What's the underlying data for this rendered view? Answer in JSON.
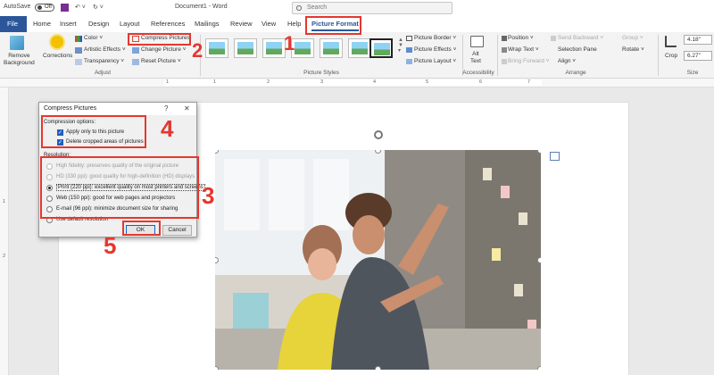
{
  "titlebar": {
    "autosave": "AutoSave",
    "toggle": "Off",
    "doc_title": "Document1 - Word",
    "search_placeholder": "Search"
  },
  "tabs": {
    "file": "File",
    "items": [
      "Home",
      "Insert",
      "Design",
      "Layout",
      "References",
      "Mailings",
      "Review",
      "View",
      "Help"
    ],
    "picture_format": "Picture Format"
  },
  "ribbon": {
    "remove_background": "Remove\nBackground",
    "corrections": "Corrections",
    "color": "Color ˅",
    "artistic_effects": "Artistic Effects ˅",
    "transparency": "Transparency ˅",
    "compress_pictures": "Compress Pictures",
    "change_picture": "Change Picture ˅",
    "reset_picture": "Reset Picture ˅",
    "adjust_group": "Adjust",
    "picture_border": "Picture Border ˅",
    "picture_effects": "Picture Effects ˅",
    "picture_layout": "Picture Layout ˅",
    "picture_styles_group": "Picture Styles",
    "alt_text": "Alt\nText",
    "accessibility_group": "Accessibility",
    "position": "Position ˅",
    "wrap_text": "Wrap Text ˅",
    "bring_forward": "Bring Forward ˅",
    "send_backward": "Send Backward ˅",
    "selection_pane": "Selection Pane",
    "align": "Align ˅",
    "group": "Group ˅",
    "rotate": "Rotate ˅",
    "arrange_group": "Arrange",
    "crop": "Crop",
    "height": "4.18\"",
    "width": "6.27\"",
    "size_group": "Size"
  },
  "ruler": {
    "ticks": [
      "1",
      "1",
      "2",
      "3",
      "4",
      "5",
      "6",
      "7"
    ],
    "left_ticks": [
      "1",
      "2"
    ]
  },
  "dialog": {
    "title": "Compress Pictures",
    "help": "?",
    "close": "✕",
    "compression_options": "Compression options:",
    "apply_only": "Apply only to this picture",
    "delete_cropped": "Delete cropped areas of pictures",
    "resolution": "Resolution:",
    "res_options": [
      "High fidelity: preserves quality of the original picture",
      "HD (330 ppi): good quality for high-definition (HD) displays",
      "Print (220 ppi): excellent quality on most printers and screens",
      "Web (150 ppi): good for web pages and projectors",
      "E-mail (96 ppi): minimize document size for sharing",
      "Use default resolution"
    ],
    "ok": "OK",
    "cancel": "Cancel"
  },
  "callouts": {
    "n1": "1",
    "n2": "2",
    "n3": "3",
    "n4": "4",
    "n5": "5"
  },
  "colors": {
    "accent": "#2b579a",
    "callout": "#e5372f"
  }
}
